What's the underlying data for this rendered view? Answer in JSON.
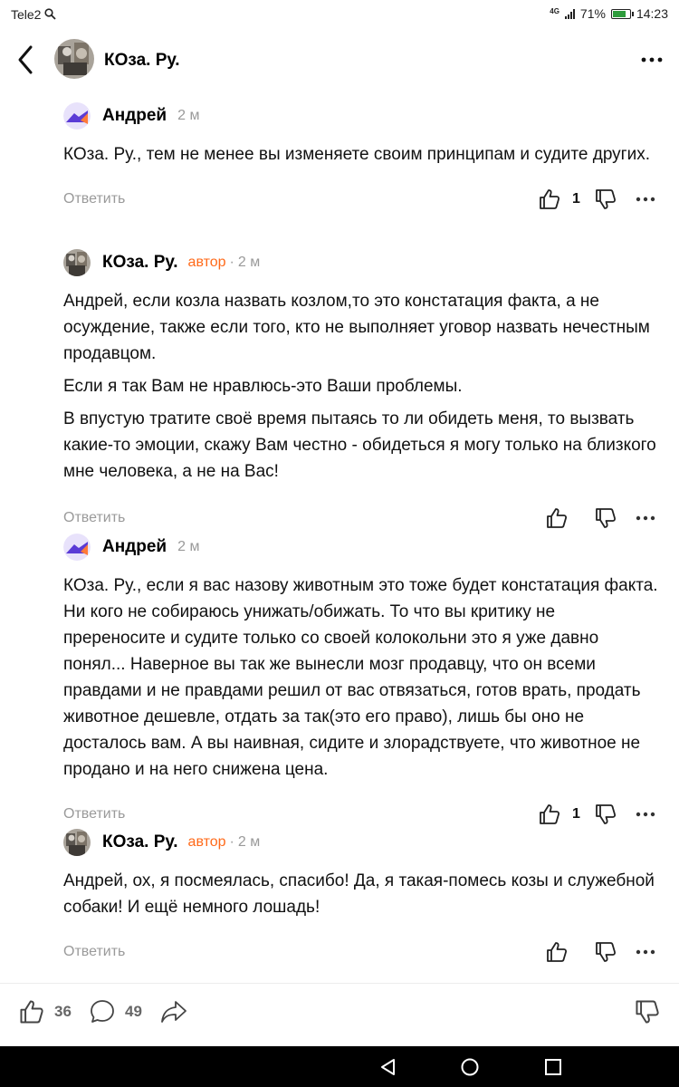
{
  "status_bar": {
    "carrier": "Tele2",
    "network": "4G",
    "battery": "71%",
    "time": "14:23"
  },
  "header": {
    "title": "КОза. Ру."
  },
  "actions": {
    "reply_label": "Ответить"
  },
  "comments": [
    {
      "author": "Андрей",
      "time": "2 м",
      "paragraphs": [
        "КОза. Ру., тем не менее вы изменяете своим принципам и судите других."
      ],
      "likes": "1"
    },
    {
      "author": "КОза. Ру.",
      "badge": "автор",
      "separator": "·",
      "time": "2 м",
      "paragraphs": [
        "Андрей, если козла назвать козлом,то это констатация факта, а не осуждение, также если того, кто не выполняет уговор назвать нечестным продавцом.",
        "Если я так Вам не нравлюсь-это Ваши проблемы.",
        "В впустую тратите своё время пытаясь то ли обидеть меня, то вызвать какие-то эмоции, скажу Вам честно - обидеться я могу только на близкого мне человека, а не на Вас!"
      ]
    },
    {
      "author": "Андрей",
      "time": "2 м",
      "paragraphs": [
        "КОза. Ру., если я вас назову животным это тоже будет констатация факта. Ни кого не собираюсь унижать/обижать. То что вы критику не пререносите и судите только со своей колокольни это я уже давно понял... Наверное вы так же вынесли мозг продавцу, что он всеми правдами и не правдами решил от вас отвязаться, готов врать, продать животное дешевле, отдать за так(это его право), лишь бы оно не досталось вам. А вы наивная, сидите и злорадствуете, что животное не продано и на него снижена цена."
      ],
      "likes": "1"
    },
    {
      "author": "КОза. Ру.",
      "badge": "автор",
      "separator": "·",
      "time": "2 м",
      "paragraphs": [
        "Андрей, ох, я посмеялась, спасибо! Да, я такая-помесь козы и служебной собаки! И ещё немного лошадь!"
      ]
    }
  ],
  "bottom_bar": {
    "likes": "36",
    "comments": "49"
  },
  "colors": {
    "accent": "#ff6a1a",
    "muted": "#9a9a9a"
  },
  "icons": [
    "back-arrow-icon",
    "more-icon",
    "thumbs-up-icon",
    "thumbs-down-icon",
    "comment-icon",
    "share-icon"
  ]
}
